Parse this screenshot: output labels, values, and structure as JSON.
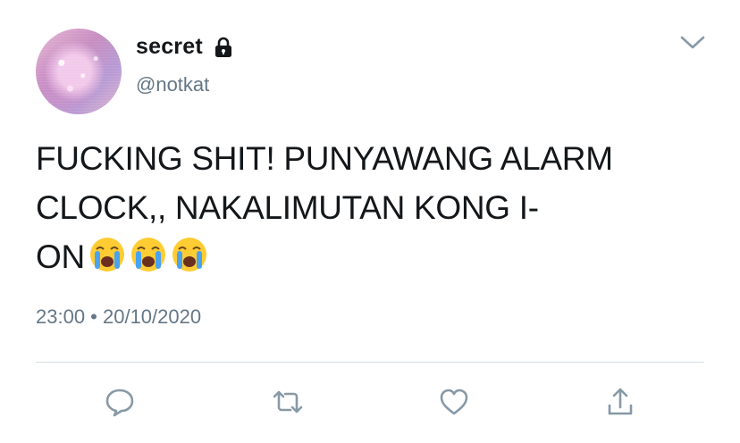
{
  "author": {
    "display_name": "secret",
    "handle": "@notkat",
    "protected_icon": "lock-icon",
    "avatar": "avatar-image"
  },
  "tweet": {
    "lines": [
      "FUCKING SHIT! PUNYAWANG ALARM",
      "CLOCK,, NAKALIMUTAN KONG I-",
      "ON"
    ],
    "emoji": [
      "loudly-crying-face",
      "loudly-crying-face",
      "loudly-crying-face"
    ],
    "timestamp": "23:00 • 20/10/2020"
  },
  "actions": [
    {
      "name": "reply",
      "icon": "comment-icon"
    },
    {
      "name": "retweet",
      "icon": "retweet-icon"
    },
    {
      "name": "like",
      "icon": "heart-icon"
    },
    {
      "name": "share",
      "icon": "share-icon"
    }
  ],
  "colors": {
    "text_primary": "#14171a",
    "text_secondary": "#657786",
    "icon_gray": "#8899a6",
    "divider": "#d5dbe0"
  }
}
